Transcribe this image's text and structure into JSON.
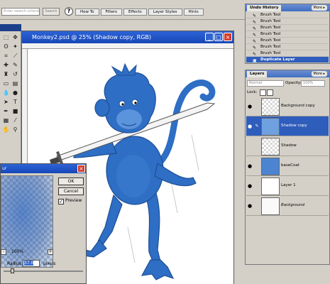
{
  "options_bar": {
    "search_placeholder": "Enter search criteria",
    "search_button": "Search",
    "help_glyph": "?",
    "wells": [
      "How To",
      "Filters",
      "Effects",
      "Layer Styles",
      "Hints"
    ]
  },
  "toolbox": {
    "tools": [
      "marquee-icon",
      "move-icon",
      "lasso-icon",
      "magic-wand-icon",
      "crop-icon",
      "slice-icon",
      "healing-icon",
      "brush-icon",
      "stamp-icon",
      "history-brush-icon",
      "eraser-icon",
      "gradient-icon",
      "blur-icon",
      "dodge-icon",
      "path-select-icon",
      "type-icon",
      "pen-icon",
      "shape-icon",
      "notes-icon",
      "eyedropper-icon",
      "hand-icon",
      "zoom-icon"
    ],
    "foreground_color": "#1f5bb0",
    "background_color": "#ffffff"
  },
  "document": {
    "title": "Monkey2.psd @ 25% (Shadow copy, RGB)",
    "min_glyph": "_",
    "max_glyph": "□",
    "close_glyph": "×"
  },
  "blur_dialog": {
    "title": "ur",
    "close_glyph": "×",
    "ok": "OK",
    "cancel": "Cancel",
    "preview_label": "Preview",
    "preview_checked": "✓",
    "zoom": "100%",
    "zoom_minus": "-",
    "zoom_plus": "+",
    "radius_label": "Radius:",
    "radius_value": "37.0",
    "radius_unit": "pixels"
  },
  "history": {
    "tab": "Undo History",
    "more": "More ▸",
    "items": [
      "Brush Tool",
      "Brush Tool",
      "Brush Tool",
      "Brush Tool",
      "Brush Tool",
      "Brush Tool",
      "Brush Tool"
    ],
    "selected_item": "Duplicate Layer"
  },
  "layers": {
    "tab": "Layers",
    "more": "More ▸",
    "blend_mode": "Normal",
    "opacity_label": "Opacity:",
    "opacity_value": "100%",
    "lock_label": "Lock:",
    "items": [
      {
        "name": "Background copy",
        "visible": "●"
      },
      {
        "name": "Shadow copy",
        "visible": "●"
      },
      {
        "name": "Shadow",
        "visible": ""
      },
      {
        "name": "baseCoat",
        "visible": "●"
      },
      {
        "name": "Layer 1",
        "visible": "●"
      },
      {
        "name": "Background",
        "visible": "●"
      }
    ],
    "accent": "#2f5dbb"
  },
  "colors": {
    "monkey_blue": "#2e6ec4",
    "title_blue": "#2d63d7",
    "panel_gray": "#d4d0c8"
  }
}
